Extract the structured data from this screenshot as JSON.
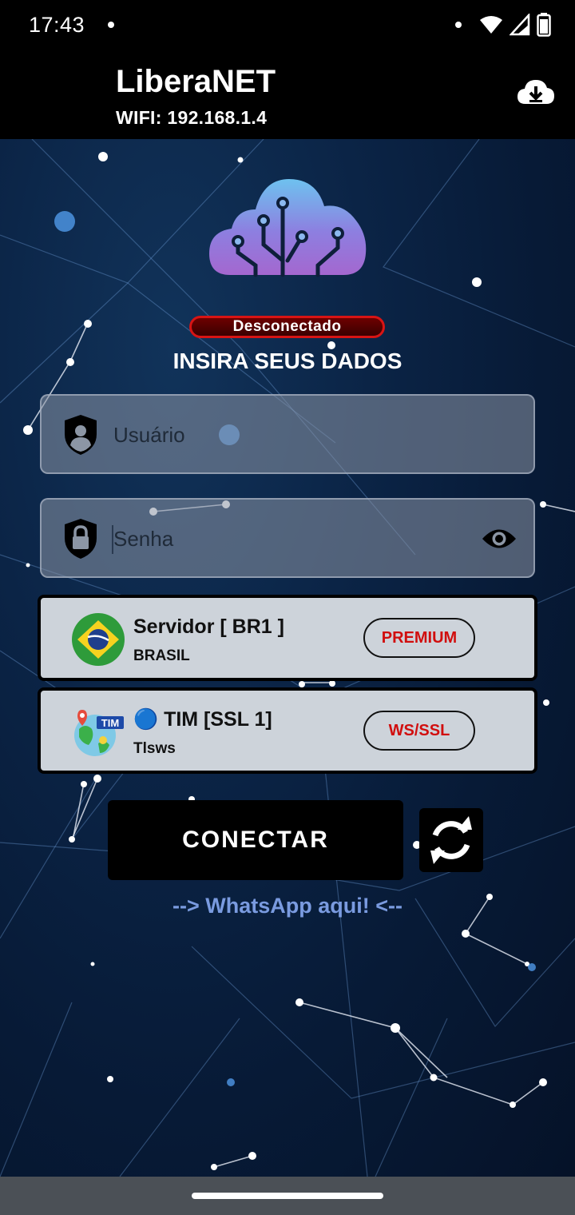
{
  "status_bar": {
    "time": "17:43"
  },
  "app_bar": {
    "title": "LiberaNET",
    "subtitle": "WIFI: 192.168.1.4"
  },
  "connection": {
    "status": "Desconectado",
    "status_color": "#d81414"
  },
  "form": {
    "heading": "INSIRA SEUS DADOS",
    "username": {
      "placeholder": "Usuário",
      "value": ""
    },
    "password": {
      "placeholder": "Senha",
      "value": ""
    }
  },
  "server_card": {
    "title": "Servidor [ BR1 ]",
    "subtitle": "BRASIL",
    "badge": "PREMIUM",
    "icon": "brazil-flag-icon"
  },
  "network_card": {
    "title": "🔵 TIM [SSL 1]",
    "subtitle": "Tlsws",
    "badge": "WS/SSL",
    "icon": "tim-globe-icon",
    "icon_label": "TIM"
  },
  "actions": {
    "connect_label": "CONECTAR",
    "whatsapp_label": "--> WhatsApp aqui! <--"
  },
  "colors": {
    "accent_link": "#7a9be0",
    "badge_text": "#d10e0e",
    "background": "#0b2446"
  }
}
